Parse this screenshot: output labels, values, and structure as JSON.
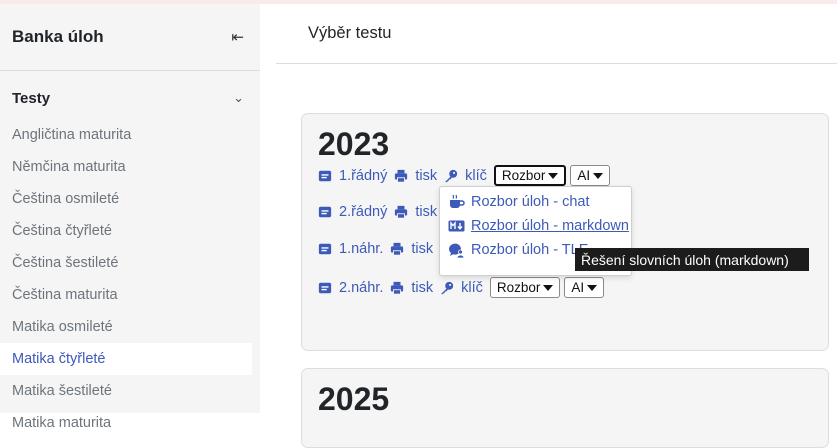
{
  "sidebar": {
    "title": "Banka úloh",
    "collapse_icon": "collapse-left-icon",
    "section_label": "Testy",
    "items": [
      {
        "label": "Angličtina maturita",
        "active": false
      },
      {
        "label": "Němčina maturita",
        "active": false
      },
      {
        "label": "Čeština osmileté",
        "active": false
      },
      {
        "label": "Čeština čtyřleté",
        "active": false
      },
      {
        "label": "Čeština šestileté",
        "active": false
      },
      {
        "label": "Čeština maturita",
        "active": false
      },
      {
        "label": "Matika osmileté",
        "active": false
      },
      {
        "label": "Matika čtyřleté",
        "active": true
      },
      {
        "label": "Matika šestileté",
        "active": false
      },
      {
        "label": "Matika maturita",
        "active": false
      }
    ]
  },
  "header": {
    "title": "Výběr testu"
  },
  "cards": [
    {
      "year": "2023",
      "rows": [
        {
          "term": "1.řádný",
          "print": "tisk",
          "key": "klíč",
          "analysis": "Rozbor",
          "ai": "AI"
        },
        {
          "term": "2.řádný",
          "print": "tisk"
        },
        {
          "term": "1.náhr.",
          "print": "tisk"
        },
        {
          "term": "2.náhr.",
          "print": "tisk",
          "key": "klíč",
          "analysis": "Rozbor",
          "ai": "AI"
        }
      ]
    },
    {
      "year": "2025"
    }
  ],
  "dropdown": {
    "items": [
      {
        "label": "Rozbor úloh - chat",
        "icon": "coffee-icon"
      },
      {
        "label": "Rozbor úloh - markdown",
        "icon": "markdown-icon"
      },
      {
        "label": "Rozbor úloh - TLE",
        "icon": "chat-user-icon"
      }
    ]
  },
  "tooltip": {
    "text": "Řešení slovních úloh (markdown)"
  },
  "colors": {
    "link": "#3d5ab8",
    "sidebar_bg": "#f5f5f5",
    "card_bg": "#f5f5f5",
    "tooltip_bg": "#1c1c1c"
  }
}
